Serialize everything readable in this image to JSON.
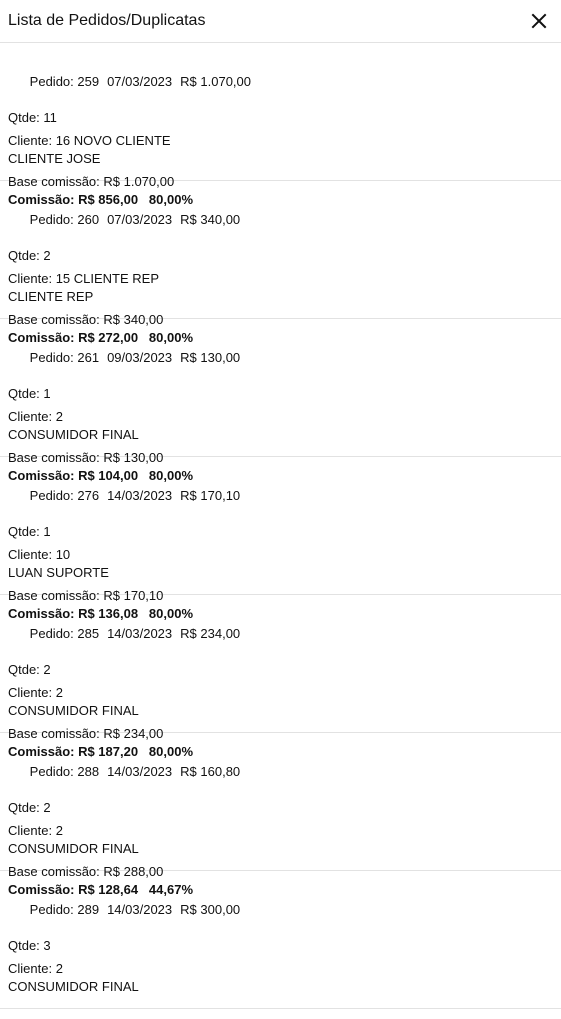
{
  "header": {
    "title": "Lista de Pedidos/Duplicatas"
  },
  "orders": [
    {
      "number": "Pedido: 259",
      "date": "07/03/2023",
      "total": "R$ 1.070,00",
      "qty": "Qtde: 11",
      "client": "Cliente: 16 NOVO CLIENTE",
      "client_name": "CLIENTE JOSE",
      "base": "Base comissão: R$ 1.070,00",
      "commission": "Comissão: R$ 856,00",
      "percent": "80,00%"
    },
    {
      "number": "Pedido: 260",
      "date": "07/03/2023",
      "total": "R$ 340,00",
      "qty": "Qtde: 2",
      "client": "Cliente: 15 CLIENTE REP",
      "client_name": "CLIENTE REP",
      "base": "Base comissão: R$ 340,00",
      "commission": "Comissão: R$ 272,00",
      "percent": "80,00%"
    },
    {
      "number": "Pedido: 261",
      "date": "09/03/2023",
      "total": "R$ 130,00",
      "qty": "Qtde: 1",
      "client": "Cliente: 2",
      "client_name": "CONSUMIDOR FINAL",
      "base": "Base comissão: R$ 130,00",
      "commission": "Comissão: R$ 104,00",
      "percent": "80,00%"
    },
    {
      "number": "Pedido: 276",
      "date": "14/03/2023",
      "total": "R$ 170,10",
      "qty": "Qtde: 1",
      "client": "Cliente: 10",
      "client_name": "LUAN SUPORTE",
      "base": "Base comissão: R$ 170,10",
      "commission": "Comissão: R$ 136,08",
      "percent": "80,00%"
    },
    {
      "number": "Pedido: 285",
      "date": "14/03/2023",
      "total": "R$ 234,00",
      "qty": "Qtde: 2",
      "client": "Cliente: 2",
      "client_name": "CONSUMIDOR FINAL",
      "base": "Base comissão: R$ 234,00",
      "commission": "Comissão: R$ 187,20",
      "percent": "80,00%"
    },
    {
      "number": "Pedido: 288",
      "date": "14/03/2023",
      "total": "R$ 160,80",
      "qty": "Qtde: 2",
      "client": "Cliente: 2",
      "client_name": "CONSUMIDOR FINAL",
      "base": "Base comissão: R$ 288,00",
      "commission": "Comissão: R$ 128,64",
      "percent": "44,67%"
    },
    {
      "number": "Pedido: 289",
      "date": "14/03/2023",
      "total": "R$ 300,00",
      "qty": "Qtde: 3",
      "client": "Cliente: 2",
      "client_name": "CONSUMIDOR FINAL",
      "base": "",
      "commission": "",
      "percent": ""
    }
  ]
}
